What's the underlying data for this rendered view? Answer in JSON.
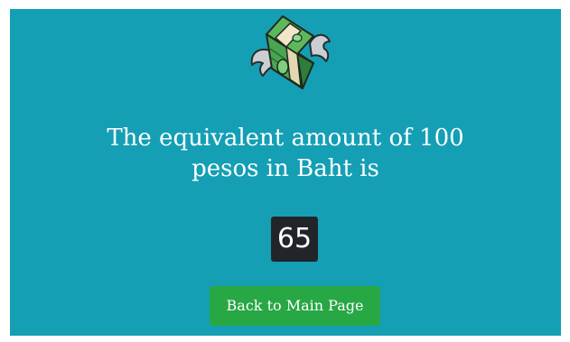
{
  "icon": {
    "name": "flying-money-icon"
  },
  "message": {
    "line1": "The equivalent amount of 100",
    "line2": "pesos in Baht is"
  },
  "result": {
    "value": "65"
  },
  "back_button": {
    "label": "Back to Main Page"
  },
  "colors": {
    "background": "#149fb5",
    "badge": "#212529",
    "button": "#28a745",
    "text": "#ffffff"
  }
}
